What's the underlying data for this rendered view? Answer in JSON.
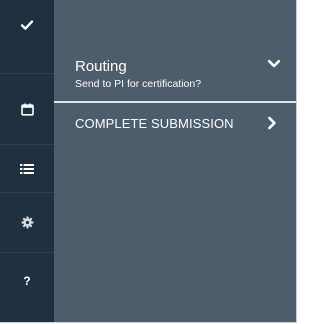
{
  "nav_rail": {
    "items": [
      {
        "icon": "check-icon"
      },
      {
        "icon": "calendar-icon"
      },
      {
        "icon": "list-icon"
      },
      {
        "icon": "gear-icon"
      },
      {
        "icon": "question-icon",
        "glyph": "?"
      }
    ]
  },
  "panel": {
    "routing": {
      "title": "Routing",
      "subtitle": "Send to PI for certification?",
      "toggle_icon": "chevron-down-icon"
    },
    "complete_submission": {
      "label": "COMPLETE SUBMISSION",
      "icon": "chevron-right-icon"
    }
  },
  "colors": {
    "rail_background": "#1f3041",
    "panel_background": "#4d5d6c",
    "divider": "#dfe4e8",
    "text": "#ffffff",
    "icon_muted": "#d6dbe0"
  }
}
